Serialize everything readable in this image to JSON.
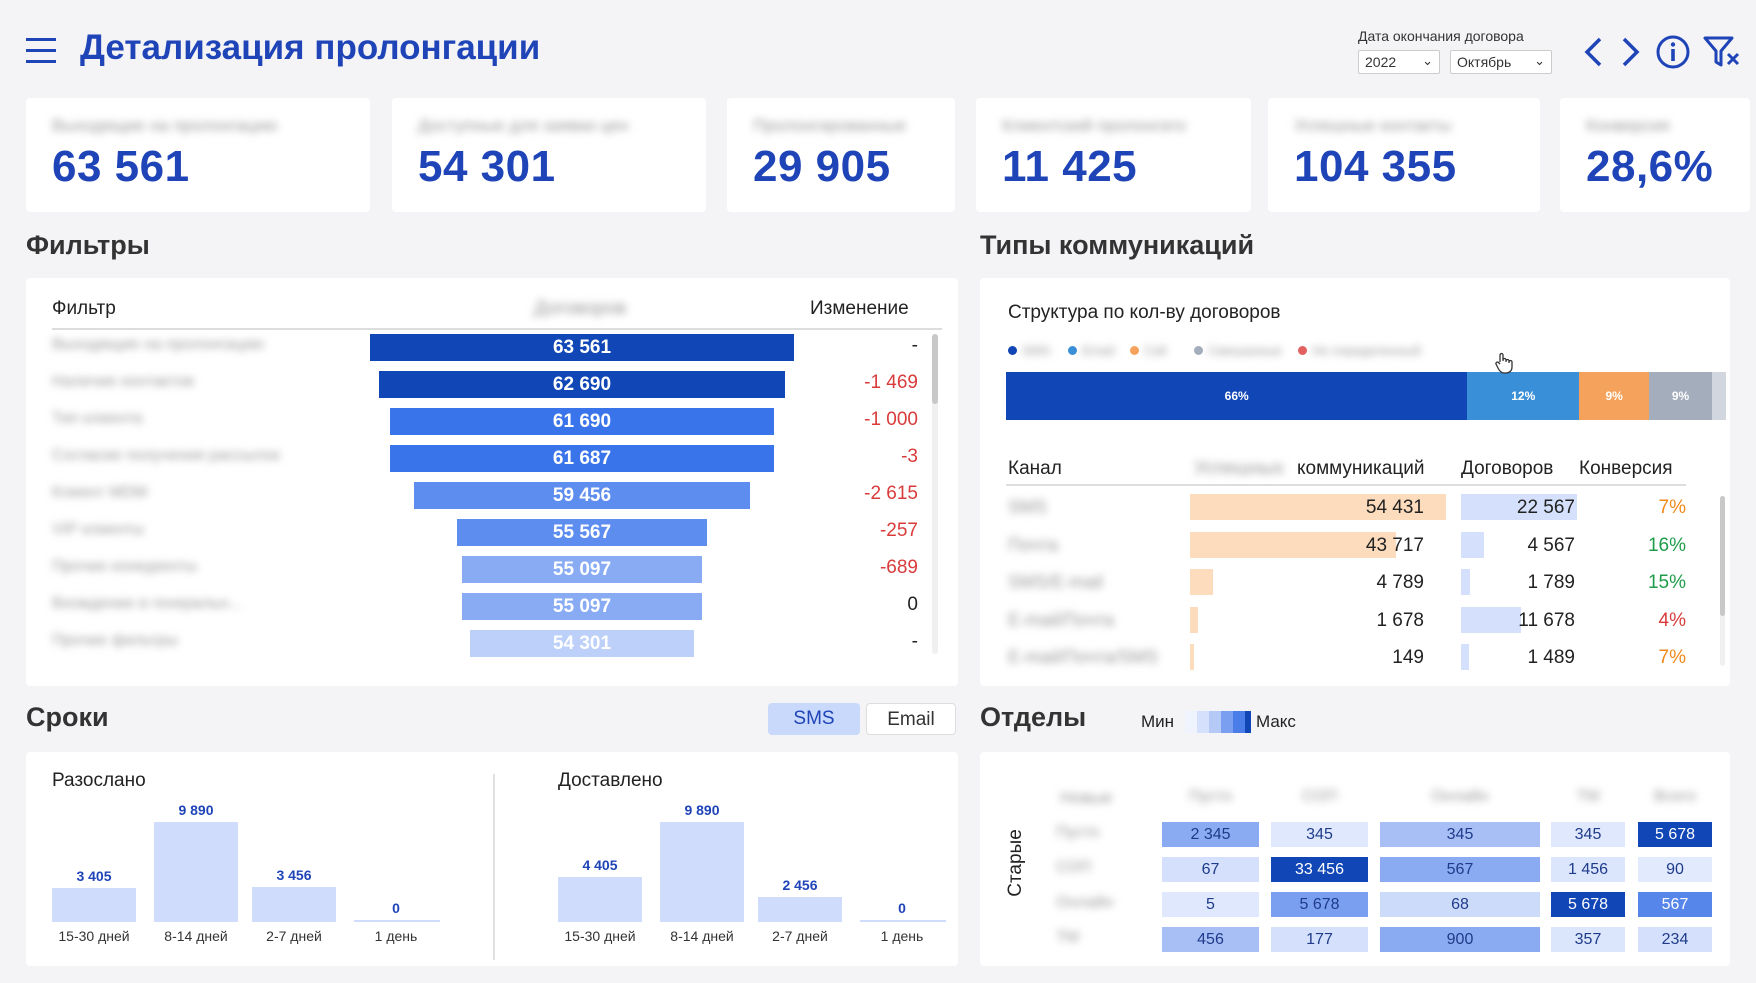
{
  "header": {
    "title": "Детализация пролонгации",
    "date_filter_label": "Дата окончания договора",
    "year": "2022",
    "month": "Октябрь"
  },
  "kpis": [
    {
      "label": "Выходящие на пролонгацию",
      "value": "63 561"
    },
    {
      "label": "Доступные для заявки цен",
      "value": "54 301"
    },
    {
      "label": "Пролонгированные",
      "value": "29 905"
    },
    {
      "label": "Клиентский пролонгато",
      "value": "11 425"
    },
    {
      "label": "Успешные контакты",
      "value": "104 355"
    },
    {
      "label": "Конверсия",
      "value": "28,6%"
    }
  ],
  "filters": {
    "title": "Фильтры",
    "col_filter": "Фильтр",
    "col_contracts": "Договоров",
    "col_change": "Изменение",
    "rows": [
      {
        "label": "Выходящие на пролонгацию",
        "value": "63 561",
        "change": "-"
      },
      {
        "label": "Наличие контактов",
        "value": "62 690",
        "change": "-1 469"
      },
      {
        "label": "Тип клиента",
        "value": "61 690",
        "change": "-1 000"
      },
      {
        "label": "Согласие получения рассылок",
        "value": "61 687",
        "change": "-3"
      },
      {
        "label": "Клиент MDM",
        "value": "59 456",
        "change": "-2 615"
      },
      {
        "label": "VIP клиенты",
        "value": "55 567",
        "change": "-257"
      },
      {
        "label": "Прочие конкуренты",
        "value": "55 097",
        "change": "-689"
      },
      {
        "label": "Вхождение в генеральн...",
        "value": "55 097",
        "change": "0"
      },
      {
        "label": "Прочие фильтры",
        "value": "54 301",
        "change": "-"
      }
    ]
  },
  "comm": {
    "title": "Типы коммуникаций",
    "structure_title": "Структура по кол-ву договоров",
    "legend": [
      "SMS",
      "Email",
      "Call",
      "Смешанные",
      "Не определенный"
    ],
    "structure": [
      {
        "label": "66%",
        "pct": 66,
        "color": "#1046b5"
      },
      {
        "label": "12%",
        "pct": 16,
        "color": "#3a8fd9"
      },
      {
        "label": "9%",
        "pct": 10,
        "color": "#f5a35c"
      },
      {
        "label": "9%",
        "pct": 9,
        "color": "#a3adbb"
      },
      {
        "label": "",
        "pct": 2,
        "color": "#d2d6de"
      }
    ],
    "col_channel": "Канал",
    "col_comm_prefix": "Успешных",
    "col_comm": "коммуникаций",
    "col_contracts": "Договоров",
    "col_conversion": "Конверсия",
    "rows": [
      {
        "channel": "SMS",
        "comm": "54 431",
        "comm_num": 54431,
        "contracts": "22 567",
        "contracts_num": 22567,
        "conv": "7%",
        "conv_color": "#f08a1c"
      },
      {
        "channel": "Почта",
        "comm": "43 717",
        "comm_num": 43717,
        "contracts": "4 567",
        "contracts_num": 4567,
        "conv": "16%",
        "conv_color": "#1f9c4a"
      },
      {
        "channel": "SMS/E-mail",
        "comm": "4 789",
        "comm_num": 4789,
        "contracts": "1 789",
        "contracts_num": 1789,
        "conv": "15%",
        "conv_color": "#1f9c4a"
      },
      {
        "channel": "E-mail/Почта",
        "comm": "1 678",
        "comm_num": 1678,
        "contracts": "11 678",
        "contracts_num": 11678,
        "conv": "4%",
        "conv_color": "#d93b3b"
      },
      {
        "channel": "E-mail/Почта/SMS",
        "comm": "149",
        "comm_num": 149,
        "contracts": "1 489",
        "contracts_num": 1489,
        "conv": "7%",
        "conv_color": "#f08a1c"
      }
    ]
  },
  "deadlines": {
    "title": "Сроки",
    "toggle": [
      "SMS",
      "Email"
    ],
    "sent": {
      "title": "Разослано",
      "cats": [
        "15-30 дней",
        "8-14 дней",
        "2-7 дней",
        "1 день"
      ],
      "labels": [
        "3 405",
        "9 890",
        "3 456",
        "0"
      ],
      "values": [
        3405,
        9890,
        3456,
        0
      ]
    },
    "delivered": {
      "title": "Доставлено",
      "cats": [
        "15-30 дней",
        "8-14 дней",
        "2-7 дней",
        "1 день"
      ],
      "labels": [
        "4 405",
        "9 890",
        "2 456",
        "0"
      ],
      "values": [
        4405,
        9890,
        2456,
        0
      ]
    }
  },
  "depts": {
    "title": "Отделы",
    "min": "Мин",
    "max": "Макс",
    "axis": "Старые",
    "corner": "Новые",
    "cols": [
      "Пусто",
      "СОП",
      "Онлайн",
      "ТМ",
      "Всего"
    ],
    "rows": [
      "Пусто",
      "СОП",
      "Онлайн",
      "ТМ"
    ],
    "cells": [
      [
        {
          "v": "2 345",
          "level": 0.55
        },
        {
          "v": "345",
          "level": 0.12
        },
        {
          "v": "345",
          "level": 0.45
        },
        {
          "v": "345",
          "level": 0.12
        },
        {
          "v": "5 678",
          "level": 1
        }
      ],
      [
        {
          "v": "67",
          "level": 0.2
        },
        {
          "v": "33 456",
          "level": 1
        },
        {
          "v": "567",
          "level": 0.55
        },
        {
          "v": "1 456",
          "level": 0.15
        },
        {
          "v": "90",
          "level": 0.1
        }
      ],
      [
        {
          "v": "5",
          "level": 0.12
        },
        {
          "v": "5 678",
          "level": 0.6
        },
        {
          "v": "68",
          "level": 0.25
        },
        {
          "v": "5 678",
          "level": 1
        },
        {
          "v": "567",
          "level": 0.75
        }
      ],
      [
        {
          "v": "456",
          "level": 0.45
        },
        {
          "v": "177",
          "level": 0.2
        },
        {
          "v": "900",
          "level": 0.55
        },
        {
          "v": "357",
          "level": 0.15
        },
        {
          "v": "234",
          "level": 0.2
        }
      ]
    ]
  }
}
